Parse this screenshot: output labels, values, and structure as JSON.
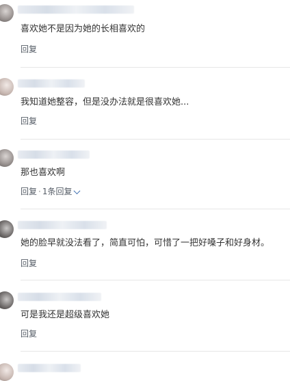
{
  "comments": [
    {
      "text": "喜欢她不是因为她的长相喜欢的",
      "reply_label": "回复"
    },
    {
      "text": "我知道她整容，但是没办法就是很喜欢她...",
      "reply_label": "回复"
    },
    {
      "text": "那也喜欢啊",
      "reply_label": "回复",
      "replies_label": "1条回复"
    },
    {
      "text": "她的脸早就没法看了，简直可怕，可惜了一把好嗓子和好身材。",
      "reply_label": "回复"
    },
    {
      "text": "可是我还是超级喜欢她",
      "reply_label": "回复"
    }
  ],
  "colors": {
    "background": "#ffffff",
    "text": "#333333",
    "link": "#3f6fb0",
    "divider": "#e6e6e6"
  },
  "icons": [
    "avatar",
    "chevron-down-icon"
  ]
}
